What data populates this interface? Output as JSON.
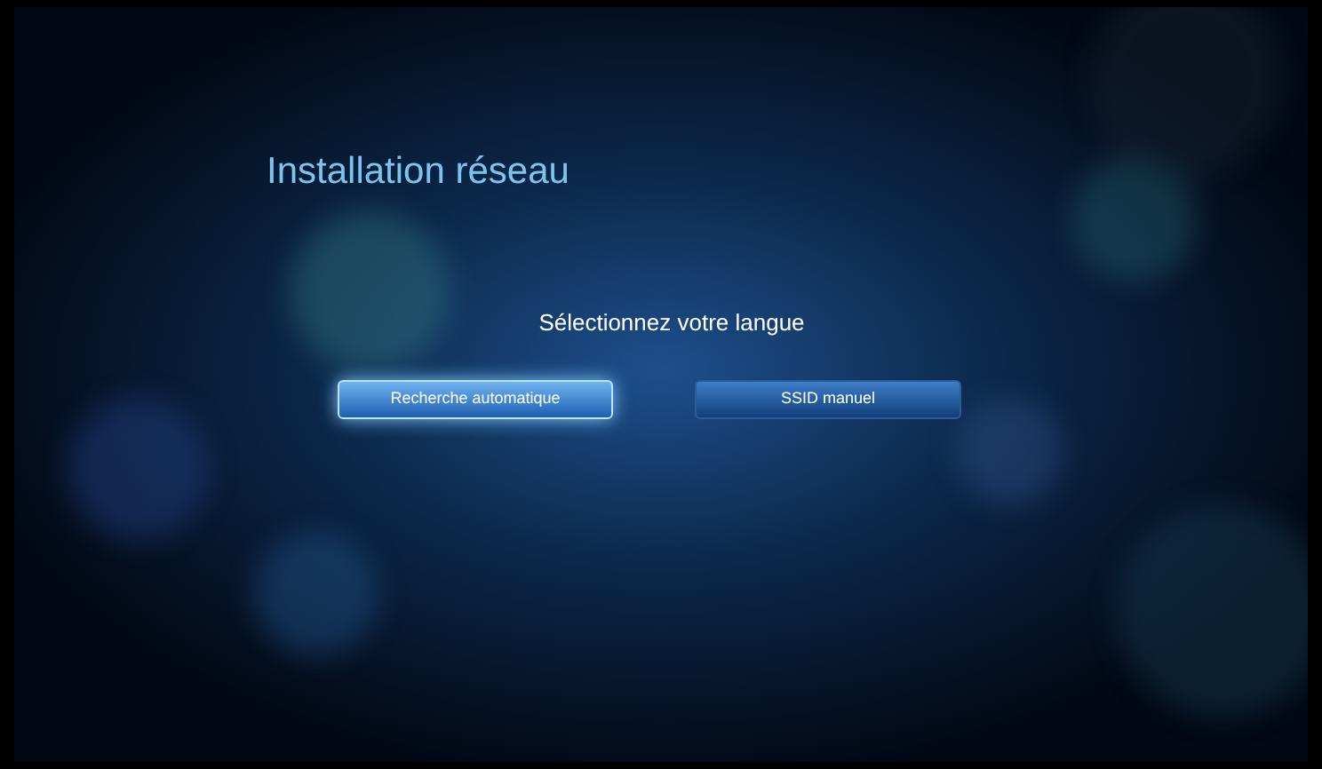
{
  "title": "Installation réseau",
  "prompt": "Sélectionnez votre langue",
  "buttons": [
    {
      "label": "Recherche automatique",
      "selected": true
    },
    {
      "label": "SSID manuel",
      "selected": false
    }
  ]
}
